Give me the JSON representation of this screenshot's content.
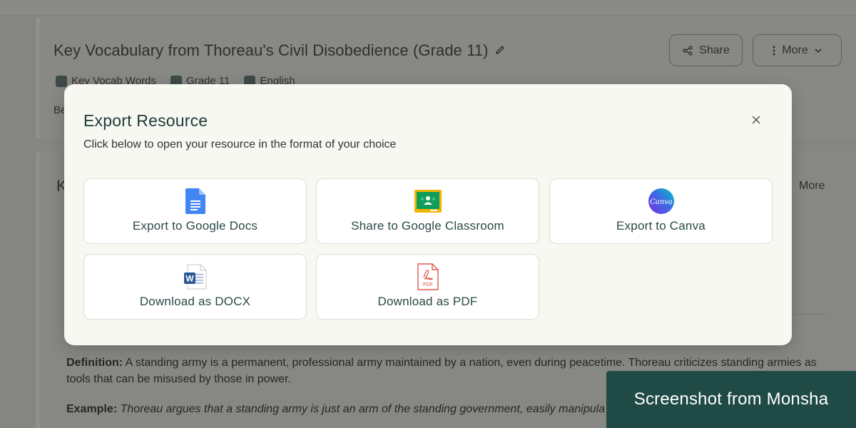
{
  "background": {
    "title": "Key Vocabulary from Thoreau's Civil Disobedience (Grade 11)",
    "share_label": "Share",
    "more_label": "More",
    "tags": [
      "Key Vocab Words",
      "Grade 11",
      "English"
    ],
    "partial_text_be": "Be",
    "section_initial": "K",
    "section_more": "More",
    "definition_label": "Definition:",
    "definition_text": " A standing army is a permanent, professional army maintained by a nation, even during peacetime. Thoreau criticizes standing armies as tools that can be misused by those in power.",
    "example_label": "Example:",
    "example_text": " Thoreau argues that a standing army is just an arm of the standing government, easily manipula"
  },
  "modal": {
    "title": "Export Resource",
    "subtitle": "Click below to open your resource in the format of your choice",
    "options": [
      {
        "label": "Export to Google Docs",
        "icon": "google-docs-icon"
      },
      {
        "label": "Share to Google Classroom",
        "icon": "google-classroom-icon"
      },
      {
        "label": "Export to Canva",
        "icon": "canva-icon",
        "icon_text": "Canva"
      },
      {
        "label": "Download as DOCX",
        "icon": "word-docx-icon",
        "icon_text": "W"
      },
      {
        "label": "Download as PDF",
        "icon": "pdf-icon",
        "icon_text": "PDF"
      }
    ]
  },
  "watermark": "Screenshot from Monsha",
  "colors": {
    "overlay_bg": "#858582",
    "modal_bg": "#f8f8f3",
    "title_color": "#1e3b38",
    "watermark_bg": "#1f4a45"
  }
}
